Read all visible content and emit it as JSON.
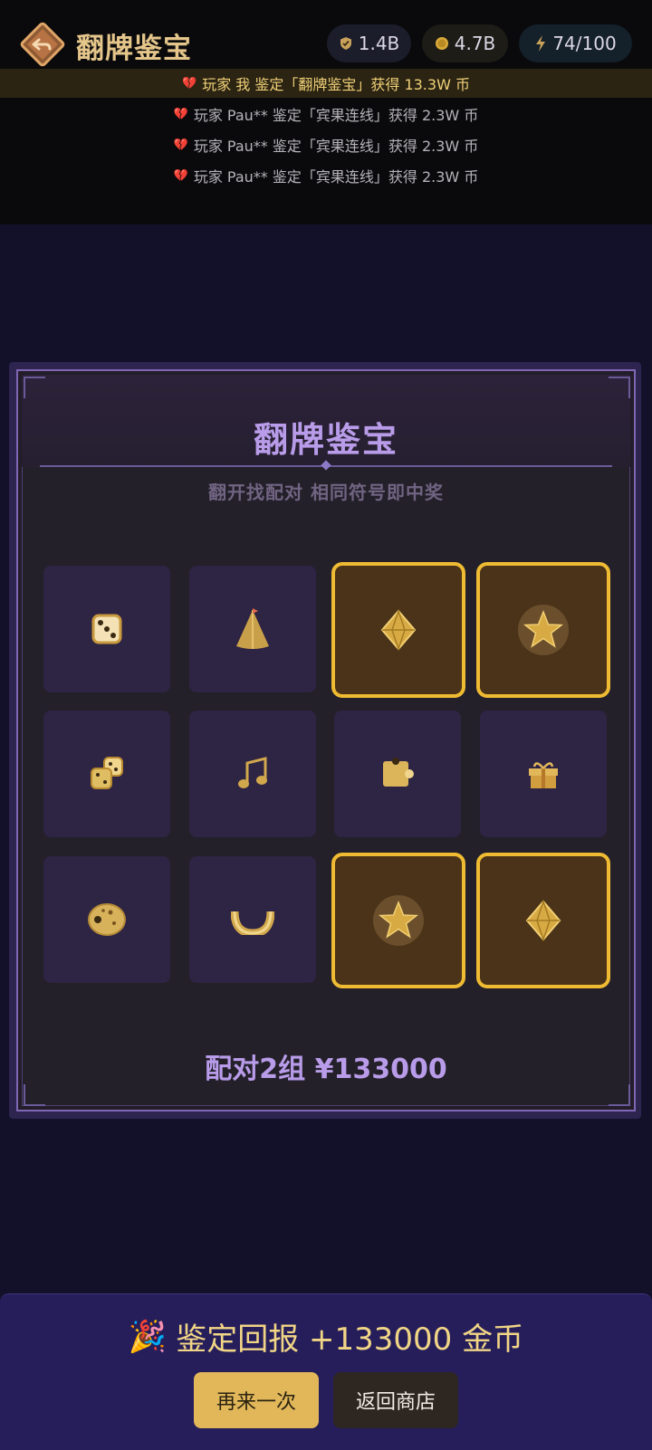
{
  "header": {
    "title": "翻牌鉴宝",
    "stats": [
      {
        "icon": "shield-coin-icon",
        "value": "1.4B"
      },
      {
        "icon": "gold-coin-icon",
        "value": "4.7B"
      },
      {
        "icon": "lightning-icon",
        "value": "74/100"
      }
    ]
  },
  "feed": {
    "highlight": "玩家 我 鉴定「翻牌鉴宝」获得 13.3W 币",
    "lines": [
      "玩家 Pau** 鉴定「宾果连线」获得 2.3W 币",
      "玩家 Pau** 鉴定「宾果连线」获得 2.3W 币",
      "玩家 Pau** 鉴定「宾果连线」获得 2.3W 币"
    ]
  },
  "board": {
    "title": "翻牌鉴宝",
    "subtitle": "翻开找配对 相同符号即中奖",
    "cards": [
      {
        "symbol": "dice-icon",
        "matched": false
      },
      {
        "symbol": "cone-icon",
        "matched": false
      },
      {
        "symbol": "diamond-icon",
        "matched": true
      },
      {
        "symbol": "star-icon",
        "matched": true
      },
      {
        "symbol": "double-dice-icon",
        "matched": false
      },
      {
        "symbol": "music-note-icon",
        "matched": false
      },
      {
        "symbol": "puzzle-piece-icon",
        "matched": false
      },
      {
        "symbol": "gift-icon",
        "matched": false
      },
      {
        "symbol": "cookie-icon",
        "matched": false
      },
      {
        "symbol": "horseshoe-icon",
        "matched": false
      },
      {
        "symbol": "star-icon",
        "matched": true
      },
      {
        "symbol": "diamond-icon",
        "matched": true
      }
    ],
    "result": "配对2组 ¥133000"
  },
  "footer": {
    "reward": "鉴定回报 +133000 金币",
    "again_label": "再来一次",
    "shop_label": "返回商店"
  },
  "colors": {
    "gold": "#efbb33",
    "purple_text": "#b99ce9",
    "card_bg": "#2e2443",
    "matched_bg": "#4a3318"
  }
}
